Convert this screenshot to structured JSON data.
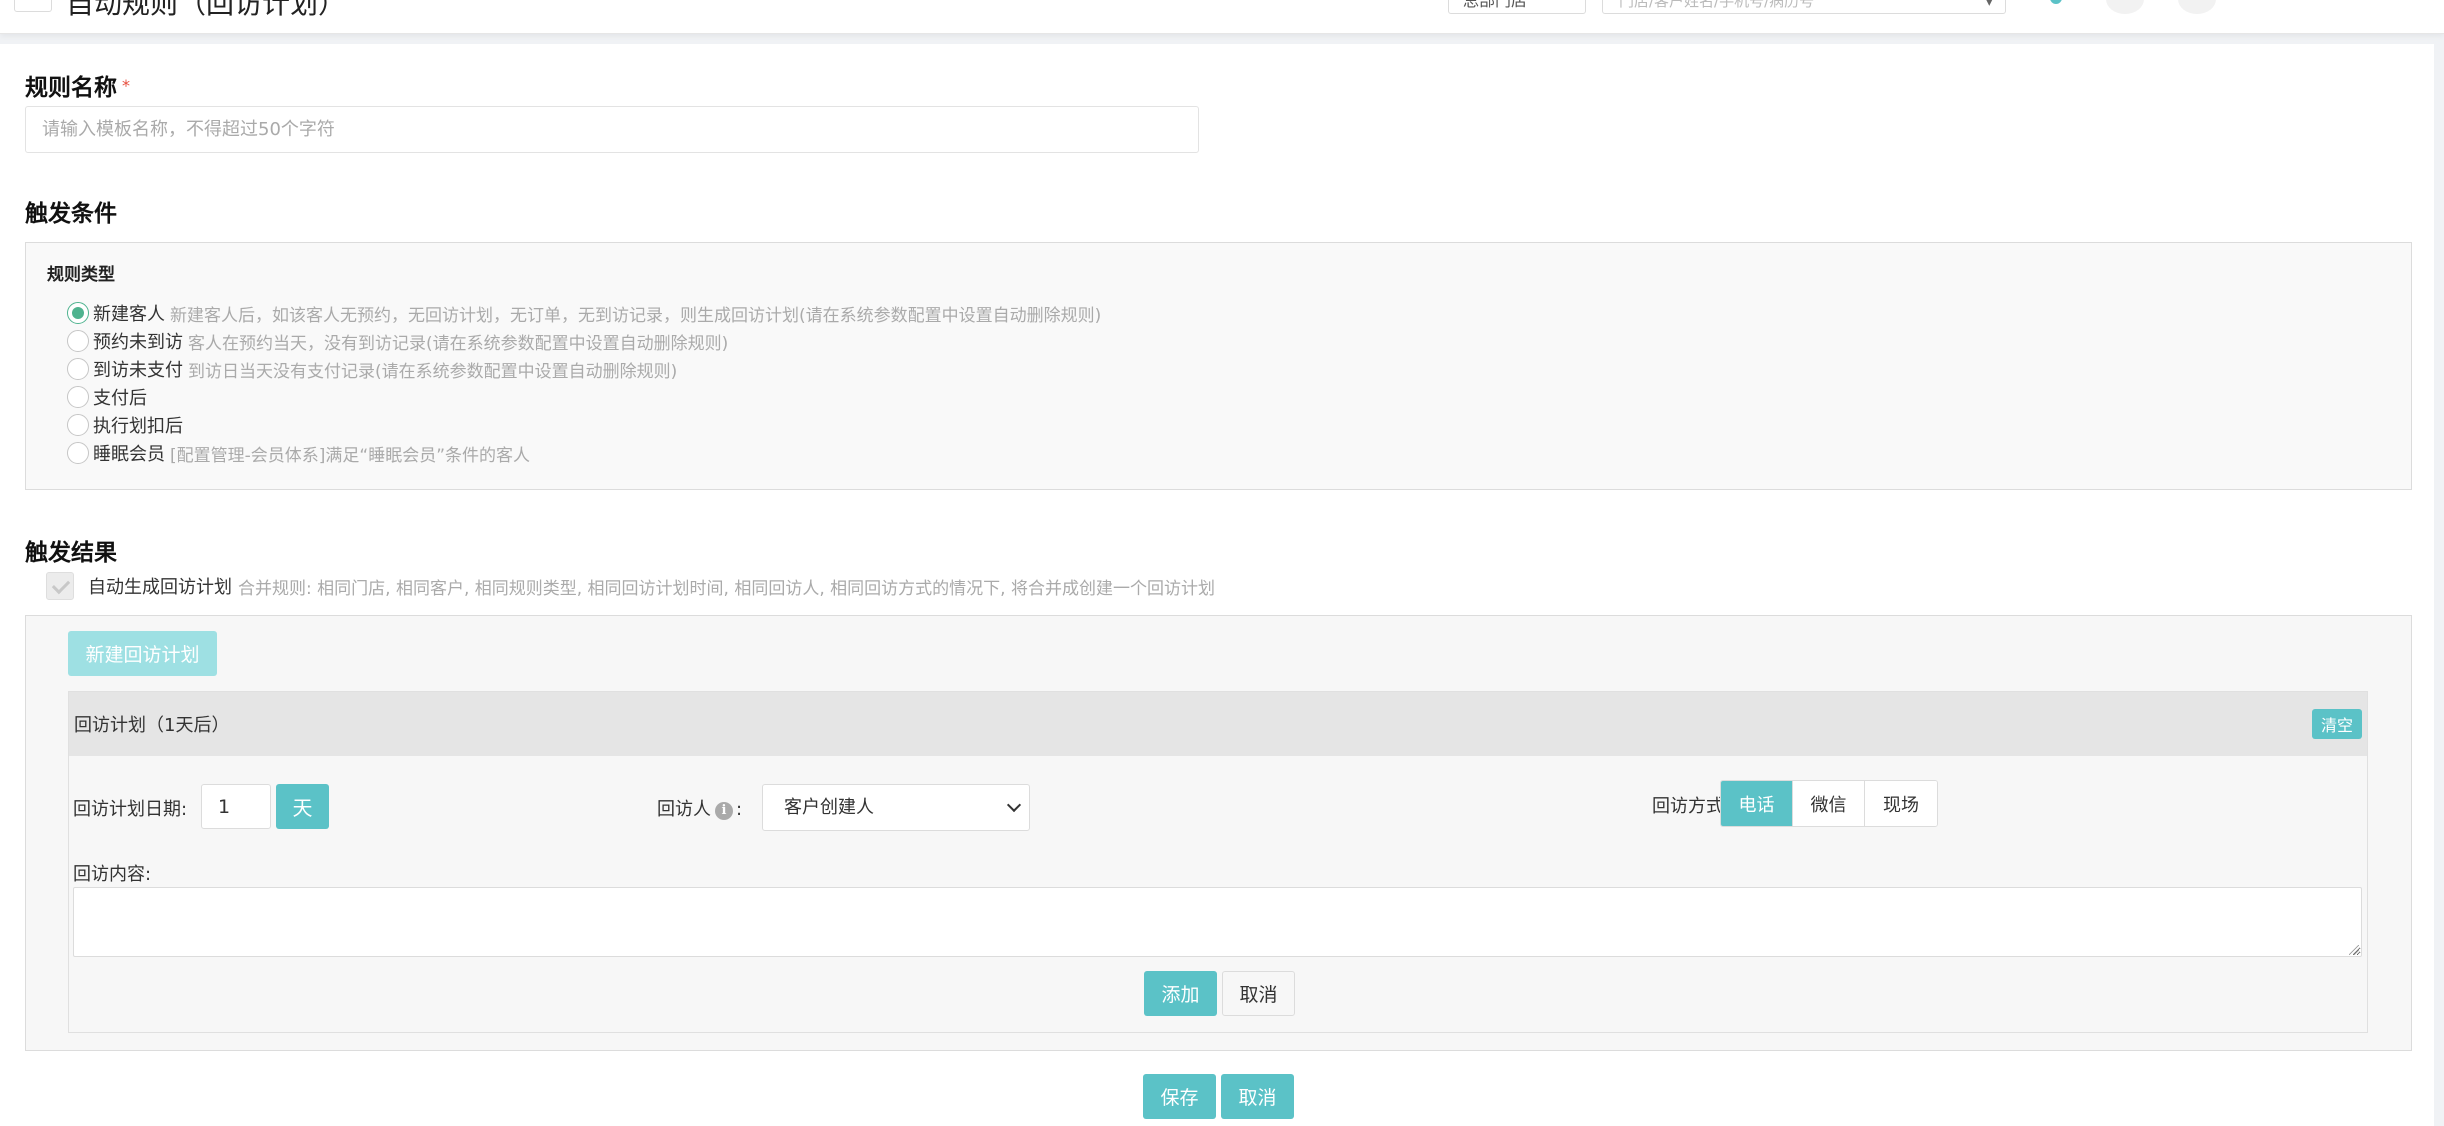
{
  "header": {
    "title": "自动规则（回访计划）",
    "store_label": "总部门店",
    "search_placeholder": "门店/客户姓名/手机号/病历号",
    "search_caret": "▾",
    "icon_5_glyph": "⌄"
  },
  "rule_name": {
    "label": "规则名称",
    "required_mark": "*",
    "placeholder": "请输入模板名称，不得超过50个字符"
  },
  "trigger_condition": {
    "title": "触发条件",
    "box_label": "规则类型",
    "options": [
      {
        "label": "新建客人",
        "desc": "新建客人后，如该客人无预约，无回访计划，无订单，无到访记录，则生成回访计划(请在系统参数配置中设置自动删除规则)",
        "checked": true
      },
      {
        "label": "预约未到访",
        "desc": "客人在预约当天，没有到访记录(请在系统参数配置中设置自动删除规则)",
        "checked": false
      },
      {
        "label": "到访未支付",
        "desc": "到访日当天没有支付记录(请在系统参数配置中设置自动删除规则)",
        "checked": false
      },
      {
        "label": "支付后",
        "desc": "",
        "checked": false
      },
      {
        "label": "执行划扣后",
        "desc": "",
        "checked": false
      },
      {
        "label": "睡眠会员",
        "desc": "[配置管理-会员体系]满足“睡眠会员”条件的客人",
        "checked": false
      }
    ]
  },
  "trigger_result": {
    "title": "触发结果",
    "auto_generate_label": "自动生成回访计划",
    "auto_generate_desc": "合并规则: 相同门店, 相同客户, 相同规则类型, 相同回访计划时间, 相同回访人, 相同回访方式的情况下, 将合并成创建一个回访计划",
    "auto_generate_checked": true,
    "new_plan_button": "新建回访计划",
    "plan": {
      "title": "回访计划（1天后）",
      "clear_button": "清空",
      "date_label": "回访计划日期:",
      "days_value": "1",
      "unit_label": "天",
      "visitor_label": "回访人",
      "info_icon_glyph": "i",
      "label_colon": ":",
      "visitor_value": "客户创建人",
      "method_label": "回访方式:",
      "methods": [
        "电话",
        "微信",
        "现场"
      ],
      "active_method": "电话",
      "content_label": "回访内容:",
      "add_button": "添加",
      "cancel_button": "取消"
    }
  },
  "footer": {
    "save_button": "保存",
    "cancel_button": "取消"
  },
  "colors": {
    "primary": "#5bc2c7",
    "primary_disabled": "#9ee0e3",
    "radio_checked": "#4fb38f",
    "required": "#e74c3c"
  }
}
